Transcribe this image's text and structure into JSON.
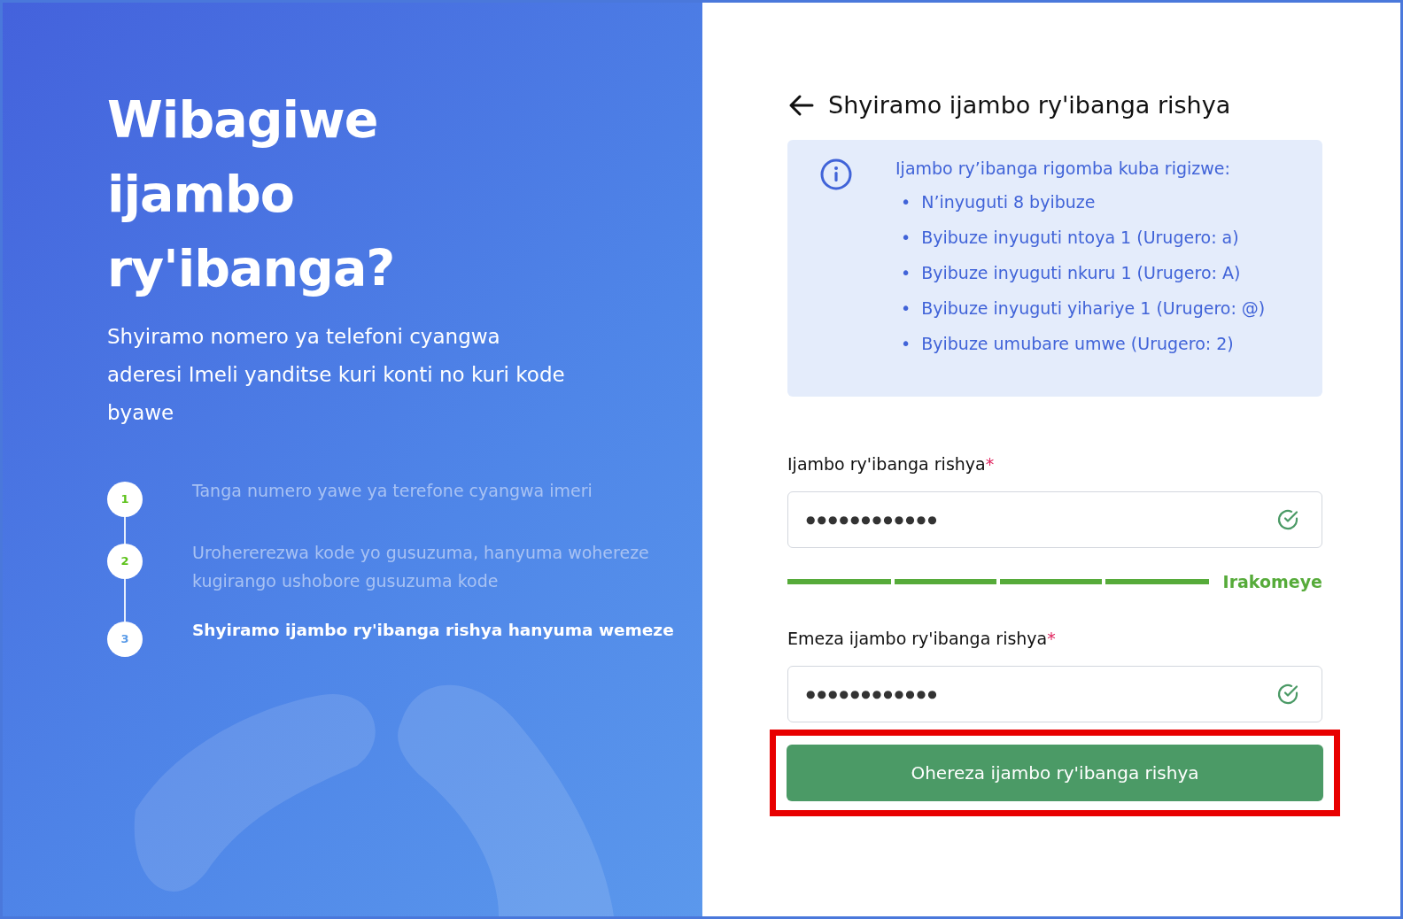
{
  "hero": {
    "title": "Wibagiwe ijambo ry'ibanga?",
    "subtitle": "Shyiramo nomero ya telefoni cyangwa aderesi Imeli yanditse kuri konti no kuri kode byawe"
  },
  "steps": [
    {
      "number": "1",
      "text": "Tanga numero yawe ya terefone cyangwa imeri",
      "selected": false
    },
    {
      "number": "2",
      "text": "Urohererezwa kode yo gusuzuma, hanyuma wohereze kugirango ushobore gusuzuma kode",
      "selected": false
    },
    {
      "number": "3",
      "text": "Shyiramo ijambo ry'ibanga rishya hanyuma wemeze",
      "selected": true
    }
  ],
  "form": {
    "title": "Shyiramo ijambo ry'ibanga rishya",
    "rules": {
      "heading": "Ijambo ry’ibanga rigomba kuba rigizwe:",
      "bullet": "•",
      "items": [
        "N’inyuguti 8 byibuze",
        "Byibuze inyuguti ntoya 1 (Urugero: a)",
        "Byibuze inyuguti nkuru 1 (Urugero: A)",
        "Byibuze inyuguti yihariye 1 (Urugero: @)",
        "Byibuze umubare umwe (Urugero: 2)"
      ]
    },
    "fields": [
      {
        "label": "Ijambo ry'ibanga rishya",
        "required": "*",
        "value": "●●●●●●●●●●●●",
        "valid": true,
        "strength": {
          "level": 1,
          "label": "Irakomeye"
        }
      },
      {
        "label": "Emeza ijambo ry'ibanga rishya",
        "required": "*",
        "value": "●●●●●●●●●●●●",
        "valid": true
      }
    ],
    "submit": {
      "label": "Ohereza ijambo ry'ibanga rishya",
      "highlighted": true
    }
  }
}
